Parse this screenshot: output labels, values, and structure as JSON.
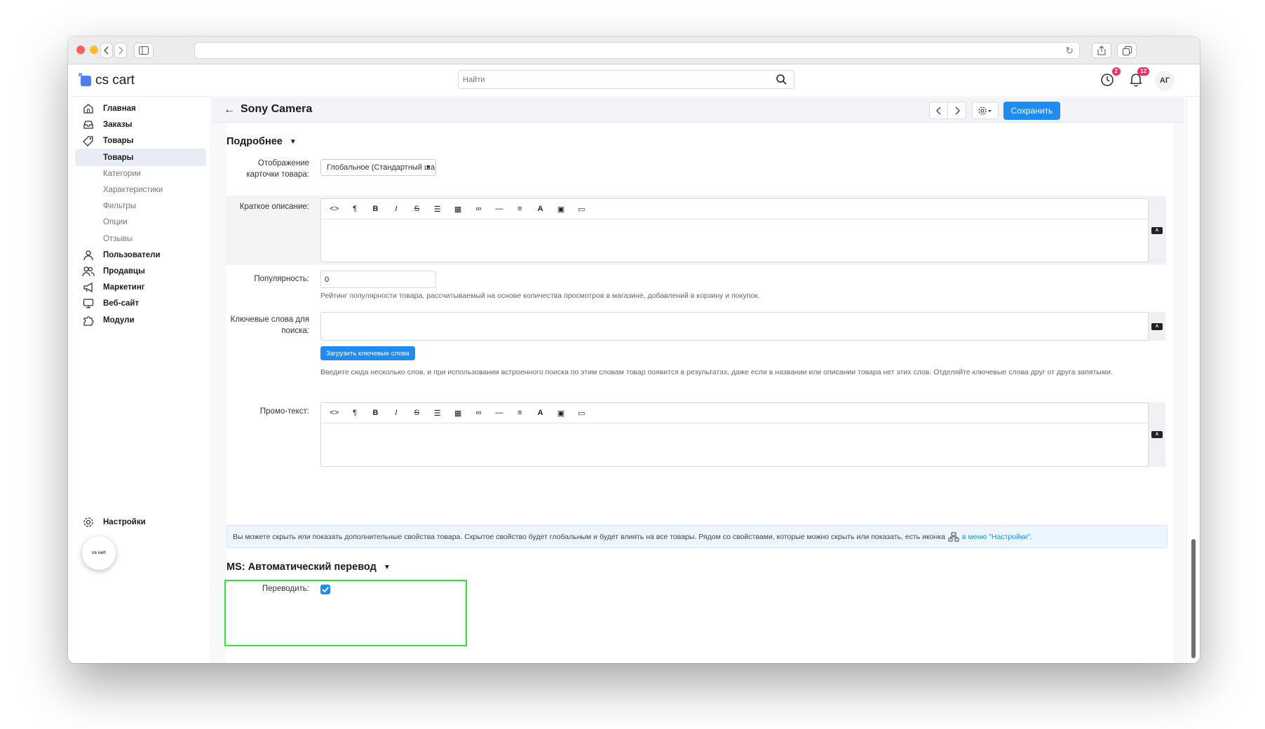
{
  "app": {
    "logo_text": "cs cart",
    "brand_color": "#1d8cf3"
  },
  "search": {
    "placeholder": "Найти"
  },
  "header": {
    "notif1_badge": "2",
    "notif2_badge": "12",
    "avatar_initials": "АГ"
  },
  "sidebar": {
    "items": [
      {
        "label": "Главная",
        "icon": "home-icon"
      },
      {
        "label": "Заказы",
        "icon": "inbox-icon"
      },
      {
        "label": "Товары",
        "icon": "tag-icon"
      },
      {
        "label": "Товары",
        "icon": "",
        "sub": true,
        "active": true
      },
      {
        "label": "Категории",
        "sub": true
      },
      {
        "label": "Характеристики",
        "sub": true
      },
      {
        "label": "Фильтры",
        "sub": true
      },
      {
        "label": "Опции",
        "sub": true
      },
      {
        "label": "Отзывы",
        "sub": true
      },
      {
        "label": "Пользователи",
        "icon": "user-icon"
      },
      {
        "label": "Продавцы",
        "icon": "users-icon"
      },
      {
        "label": "Маркетинг",
        "icon": "megaphone-icon"
      },
      {
        "label": "Веб-сайт",
        "icon": "monitor-icon"
      },
      {
        "label": "Модули",
        "icon": "puzzle-icon"
      }
    ],
    "settings_label": "Настройки",
    "mini_logo": "cs cart"
  },
  "page": {
    "title": "Sony Camera",
    "save_label": "Сохранить"
  },
  "details": {
    "section_title": "Подробнее",
    "card_display_label": "Отображение карточки товара:",
    "card_display_value": "Глобальное (Стандартный ша",
    "short_desc_label": "Краткое описание:",
    "popularity_label": "Популярность:",
    "popularity_value": "0",
    "popularity_help": "Рейтинг популярности товара, рассчитываемый на основе количества просмотров в магазине, добавлений в корзину и покупок.",
    "keywords_label": "Ключевые слова для поиска:",
    "keywords_button": "Загрузить ключевые слова",
    "keywords_help": "Введите сюда несколько слов, и при использовании встроенного поиска по этим словам товар появится в результатах, даже если в названии или описании товара нет этих слов. Отделяйте ключевые слова друг от друга запятыми.",
    "promo_label": "Промо-текст:",
    "info_text": "Вы можете скрыть или показать дополнительные свойства товара. Скрытое свойство будет глобальным и будет влиять на все товары. Рядом со свойствами, которые можно скрыть или показать, есть иконка",
    "info_link": "в меню \"Настройки\"."
  },
  "translation": {
    "section_title": "MS: Автоматический перевод",
    "translate_label": "Переводить:",
    "translate_checked": true
  },
  "editor_tools": [
    "<>",
    "¶",
    "B",
    "I",
    "S",
    "list-ul",
    "list-table",
    "link",
    "hr",
    "align",
    "A",
    "image",
    "video"
  ]
}
